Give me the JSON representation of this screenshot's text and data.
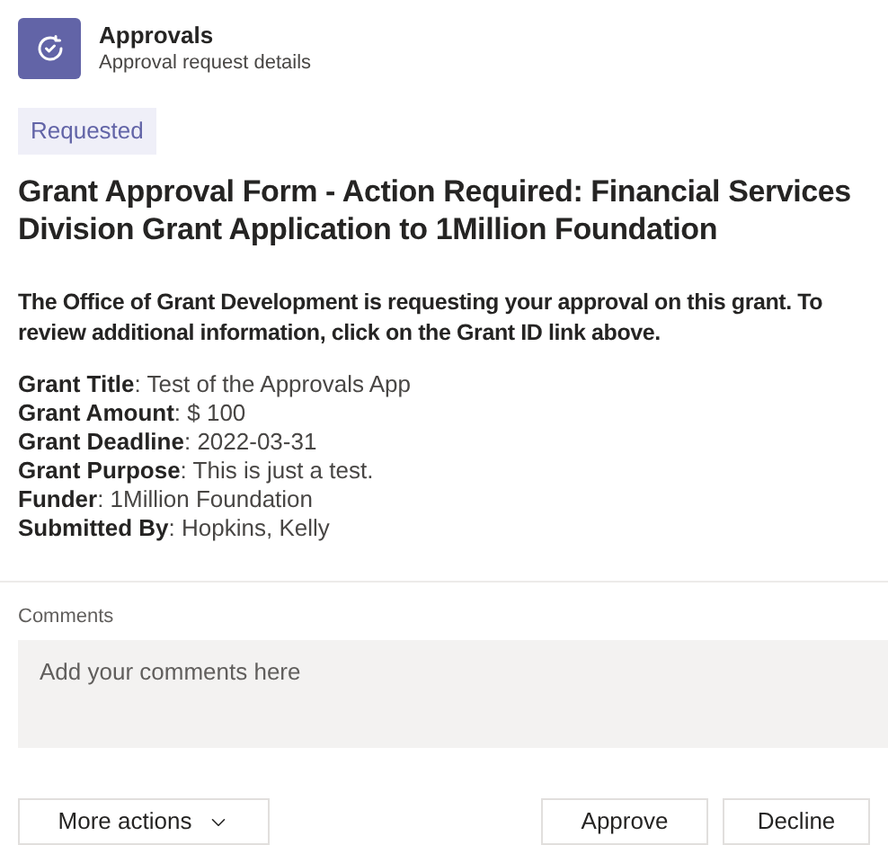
{
  "header": {
    "title": "Approvals",
    "subtitle": "Approval request details"
  },
  "status": "Requested",
  "title": "Grant Approval Form - Action Required: Financial Services Division Grant Application to 1Million Foundation",
  "message": "The Office of Grant Development is requesting your approval on this grant. To review additional information, click on the Grant ID link above.",
  "fields": [
    "**Grant Title**: Test of the Approvals App",
    "**Grant Amount**: $ 100",
    "**Grant Deadline**: 2022-03-31",
    "**Grant Purpose**: This is just a test.",
    "**Funder**: 1Million Foundation",
    "**Submitted By**: Hopkins, Kelly"
  ],
  "comments": {
    "label": "Comments",
    "placeholder": "Add your comments here"
  },
  "more_actions": "More actions",
  "buttons": [
    "Approve",
    "Decline"
  ]
}
